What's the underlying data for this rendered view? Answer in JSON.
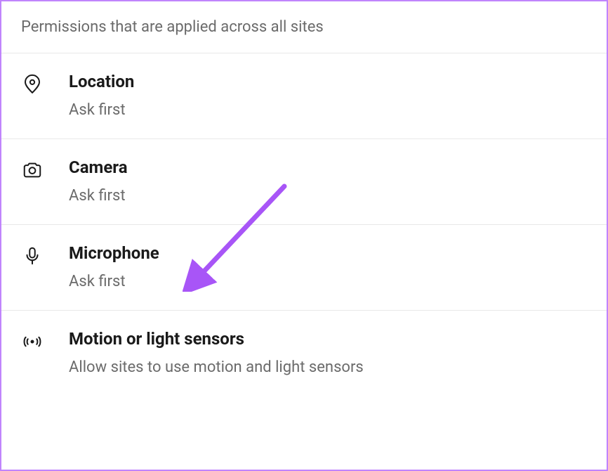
{
  "header": {
    "title": "Permissions that are applied across all sites"
  },
  "items": [
    {
      "id": "location",
      "title": "Location",
      "subtitle": "Ask first"
    },
    {
      "id": "camera",
      "title": "Camera",
      "subtitle": "Ask first"
    },
    {
      "id": "microphone",
      "title": "Microphone",
      "subtitle": "Ask first"
    },
    {
      "id": "motion-sensors",
      "title": "Motion or light sensors",
      "subtitle": "Allow sites to use motion and light sensors"
    }
  ],
  "annotation": {
    "arrow_color": "#a855f7"
  }
}
